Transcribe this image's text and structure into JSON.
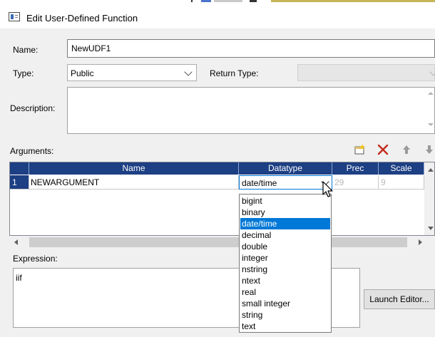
{
  "window": {
    "title": "Edit User-Defined Function"
  },
  "form": {
    "name_label": "Name:",
    "name_value": "NewUDF1",
    "type_label": "Type:",
    "type_value": "Public",
    "return_type_label": "Return Type:",
    "return_type_value": "",
    "description_label": "Description:",
    "description_value": ""
  },
  "arguments": {
    "label": "Arguments:",
    "toolbar": {
      "add": "new-argument-icon",
      "delete": "delete-icon",
      "up": "move-up-icon",
      "down": "move-down-icon"
    },
    "columns": [
      "Name",
      "Datatype",
      "Prec",
      "Scale"
    ],
    "rows": [
      {
        "index": "1",
        "name": "NEWARGUMENT",
        "datatype": "date/time",
        "prec": "29",
        "scale": "9"
      }
    ]
  },
  "datatype_dropdown": {
    "options": [
      "bigint",
      "binary",
      "date/time",
      "decimal",
      "double",
      "integer",
      "nstring",
      "ntext",
      "real",
      "small integer",
      "string",
      "text"
    ],
    "selected": "date/time"
  },
  "expression": {
    "label": "Expression:",
    "value": "iif"
  },
  "launch_editor_button": "Launch Editor...",
  "colors": {
    "header_bg": "#1d3f83",
    "selection": "#0078d7",
    "delete_red": "#c42b1c"
  }
}
